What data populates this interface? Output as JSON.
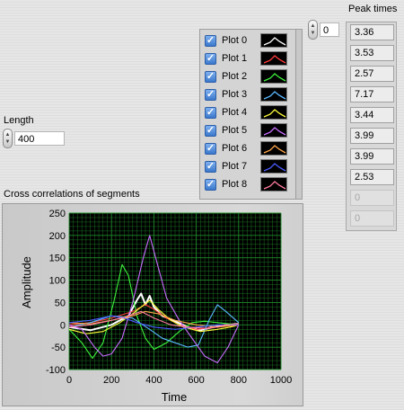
{
  "length_control": {
    "label": "Length",
    "value": "400"
  },
  "index_control": {
    "value": "0"
  },
  "peak_times": {
    "label": "Peak times",
    "values": [
      "3.36",
      "3.53",
      "2.57",
      "7.17",
      "3.44",
      "3.99",
      "3.99",
      "2.53",
      "0",
      "0"
    ]
  },
  "legend": {
    "items": [
      {
        "name": "Plot 0",
        "color": "#ffffff",
        "checked": true
      },
      {
        "name": "Plot 1",
        "color": "#ff3b3b",
        "checked": true
      },
      {
        "name": "Plot 2",
        "color": "#3cf03c",
        "checked": true
      },
      {
        "name": "Plot 3",
        "color": "#5ab8ff",
        "checked": true
      },
      {
        "name": "Plot 4",
        "color": "#ffff3c",
        "checked": true
      },
      {
        "name": "Plot 5",
        "color": "#c86cff",
        "checked": true
      },
      {
        "name": "Plot 6",
        "color": "#ffa64a",
        "checked": true
      },
      {
        "name": "Plot 7",
        "color": "#4a5cff",
        "checked": true
      },
      {
        "name": "Plot 8",
        "color": "#ff7aa0",
        "checked": true
      }
    ]
  },
  "graph": {
    "title": "Cross correlations of segments",
    "plot_bg": "#000000",
    "grid_color": "#1f8a2a",
    "check_color": "#3a78cc"
  },
  "chart_data": {
    "type": "line",
    "title": "Cross correlations of segments",
    "xlabel": "Time",
    "ylabel": "Amplitude",
    "xlim": [
      0,
      1000
    ],
    "ylim": [
      -100,
      250
    ],
    "xticks": [
      "0",
      "200",
      "400",
      "600",
      "800",
      "1000"
    ],
    "yticks": [
      "-100",
      "-50",
      "0",
      "50",
      "100",
      "150",
      "200",
      "250"
    ],
    "grid": true,
    "legend": "top-right",
    "series": [
      {
        "name": "Plot 0",
        "color": "#ffffff",
        "points": [
          [
            0,
            -5
          ],
          [
            100,
            -12
          ],
          [
            200,
            0
          ],
          [
            280,
            20
          ],
          [
            320,
            55
          ],
          [
            340,
            70
          ],
          [
            360,
            45
          ],
          [
            380,
            65
          ],
          [
            400,
            40
          ],
          [
            440,
            20
          ],
          [
            500,
            8
          ],
          [
            560,
            -5
          ],
          [
            620,
            -12
          ],
          [
            680,
            -5
          ],
          [
            740,
            0
          ],
          [
            800,
            2
          ]
        ]
      },
      {
        "name": "Plot 1",
        "color": "#ff3b3b",
        "points": [
          [
            0,
            0
          ],
          [
            100,
            5
          ],
          [
            200,
            15
          ],
          [
            300,
            30
          ],
          [
            360,
            45
          ],
          [
            400,
            35
          ],
          [
            460,
            15
          ],
          [
            520,
            0
          ],
          [
            600,
            -10
          ],
          [
            700,
            -5
          ],
          [
            800,
            0
          ]
        ]
      },
      {
        "name": "Plot 2",
        "color": "#3cf03c",
        "points": [
          [
            0,
            -10
          ],
          [
            60,
            -40
          ],
          [
            110,
            -75
          ],
          [
            160,
            -40
          ],
          [
            210,
            50
          ],
          [
            250,
            135
          ],
          [
            280,
            110
          ],
          [
            320,
            20
          ],
          [
            360,
            -30
          ],
          [
            400,
            -55
          ],
          [
            460,
            -40
          ],
          [
            520,
            -15
          ],
          [
            580,
            5
          ],
          [
            640,
            8
          ],
          [
            700,
            5
          ],
          [
            760,
            2
          ],
          [
            800,
            0
          ]
        ]
      },
      {
        "name": "Plot 3",
        "color": "#5ab8ff",
        "points": [
          [
            0,
            -5
          ],
          [
            100,
            5
          ],
          [
            200,
            20
          ],
          [
            300,
            15
          ],
          [
            380,
            -10
          ],
          [
            440,
            -30
          ],
          [
            500,
            -40
          ],
          [
            560,
            -50
          ],
          [
            610,
            -45
          ],
          [
            660,
            10
          ],
          [
            700,
            45
          ],
          [
            740,
            30
          ],
          [
            800,
            5
          ]
        ]
      },
      {
        "name": "Plot 4",
        "color": "#ffff3c",
        "points": [
          [
            0,
            -10
          ],
          [
            80,
            -20
          ],
          [
            160,
            -15
          ],
          [
            240,
            5
          ],
          [
            300,
            25
          ],
          [
            340,
            40
          ],
          [
            380,
            55
          ],
          [
            420,
            35
          ],
          [
            480,
            10
          ],
          [
            540,
            -5
          ],
          [
            620,
            -15
          ],
          [
            700,
            -10
          ],
          [
            760,
            -5
          ],
          [
            800,
            0
          ]
        ]
      },
      {
        "name": "Plot 5",
        "color": "#c86cff",
        "points": [
          [
            0,
            0
          ],
          [
            60,
            -10
          ],
          [
            120,
            -50
          ],
          [
            160,
            -70
          ],
          [
            200,
            -65
          ],
          [
            250,
            -30
          ],
          [
            300,
            50
          ],
          [
            350,
            150
          ],
          [
            380,
            200
          ],
          [
            420,
            130
          ],
          [
            460,
            60
          ],
          [
            520,
            10
          ],
          [
            580,
            -30
          ],
          [
            640,
            -70
          ],
          [
            700,
            -85
          ],
          [
            750,
            -50
          ],
          [
            800,
            0
          ]
        ]
      },
      {
        "name": "Plot 6",
        "color": "#ffa64a",
        "points": [
          [
            0,
            5
          ],
          [
            100,
            2
          ],
          [
            200,
            10
          ],
          [
            300,
            20
          ],
          [
            360,
            30
          ],
          [
            420,
            25
          ],
          [
            500,
            10
          ],
          [
            600,
            0
          ],
          [
            700,
            -5
          ],
          [
            800,
            0
          ]
        ]
      },
      {
        "name": "Plot 7",
        "color": "#4a5cff",
        "points": [
          [
            0,
            5
          ],
          [
            100,
            10
          ],
          [
            200,
            20
          ],
          [
            260,
            15
          ],
          [
            320,
            5
          ],
          [
            400,
            -5
          ],
          [
            500,
            -10
          ],
          [
            600,
            -5
          ],
          [
            700,
            0
          ],
          [
            800,
            0
          ]
        ]
      },
      {
        "name": "Plot 8",
        "color": "#ff7aa0",
        "points": [
          [
            0,
            -5
          ],
          [
            100,
            0
          ],
          [
            200,
            10
          ],
          [
            280,
            20
          ],
          [
            340,
            30
          ],
          [
            400,
            15
          ],
          [
            480,
            0
          ],
          [
            560,
            -5
          ],
          [
            660,
            -8
          ],
          [
            740,
            0
          ],
          [
            800,
            2
          ]
        ]
      }
    ]
  }
}
